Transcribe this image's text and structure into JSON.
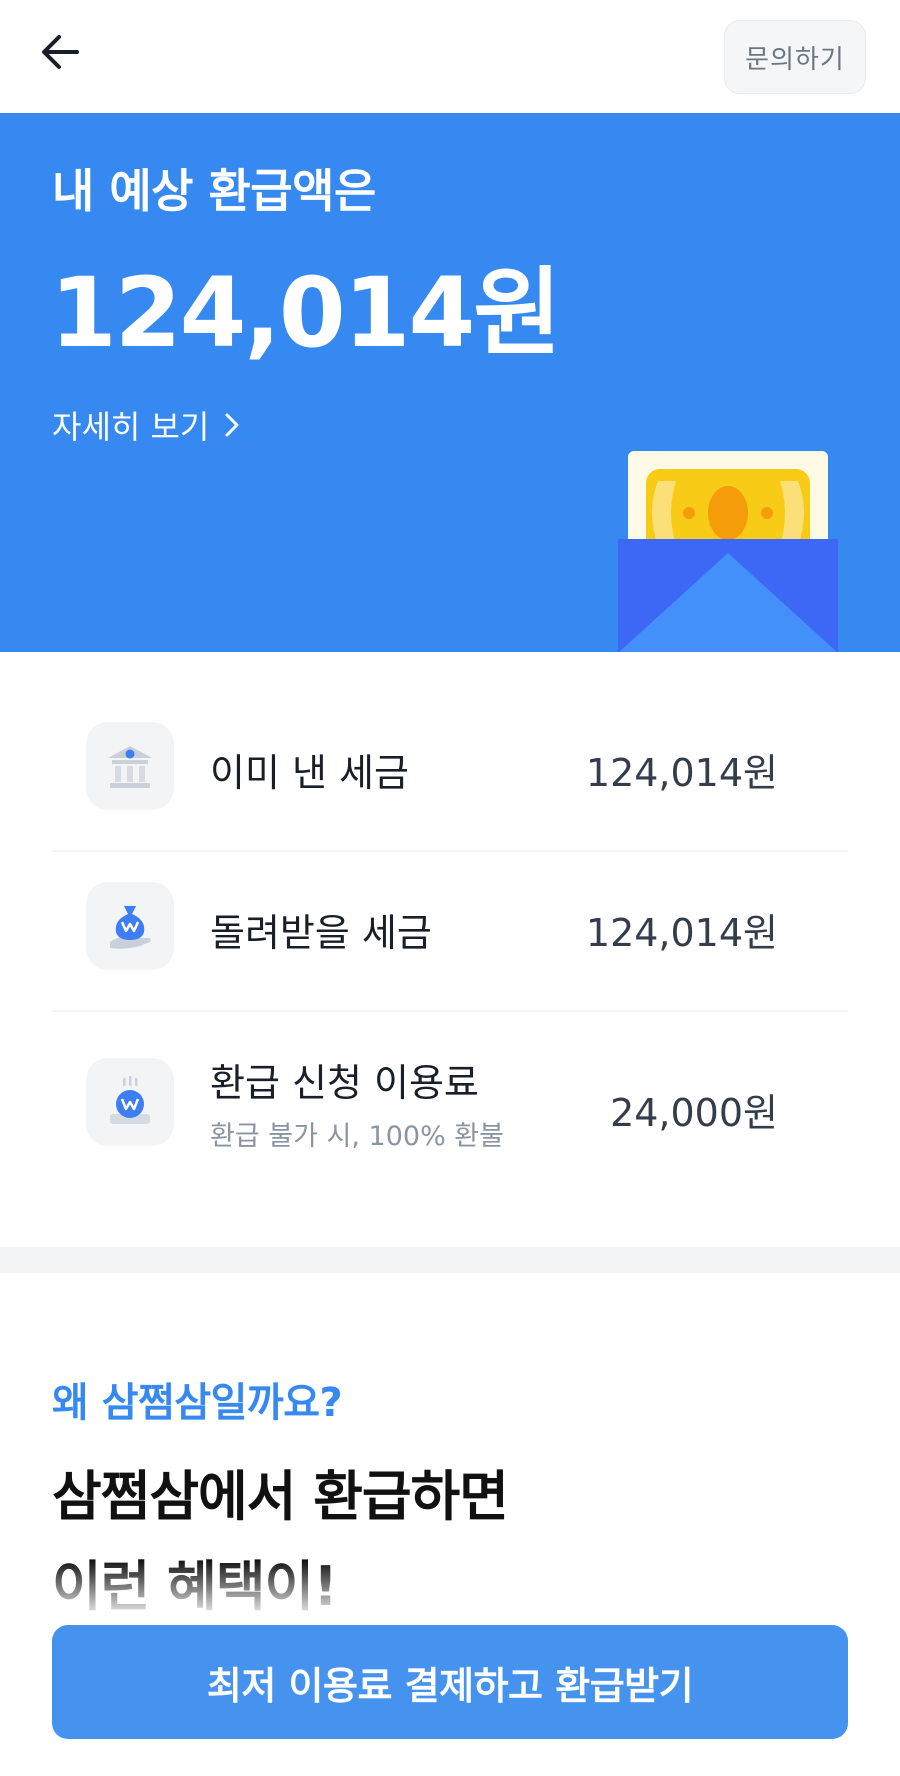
{
  "header": {
    "inquiry_label": "문의하기"
  },
  "hero": {
    "subtitle": "내 예상 환급액은",
    "amount": "124,014원",
    "detail_link": "자세히 보기"
  },
  "summary": {
    "rows": [
      {
        "icon": "bank-icon",
        "label": "이미 낸 세금",
        "value": "124,014원"
      },
      {
        "icon": "money-bag-icon",
        "label": "돌려받을 세금",
        "value": "124,014원"
      },
      {
        "icon": "service-fee-icon",
        "label": "환급 신청 이용료",
        "note": "환급 불가 시, 100% 환불",
        "value": "24,000원"
      }
    ]
  },
  "benefits": {
    "question": "왜 삼쩜삼일까요?",
    "headline_line1": "삼쩜삼에서 환급하면",
    "headline_line2": "이런 혜택이!"
  },
  "cta": {
    "label": "최저 이용료 결제하고 환급받기"
  },
  "colors": {
    "primary": "#3589f0",
    "button": "#4592ef",
    "note": "#8b95a1"
  }
}
